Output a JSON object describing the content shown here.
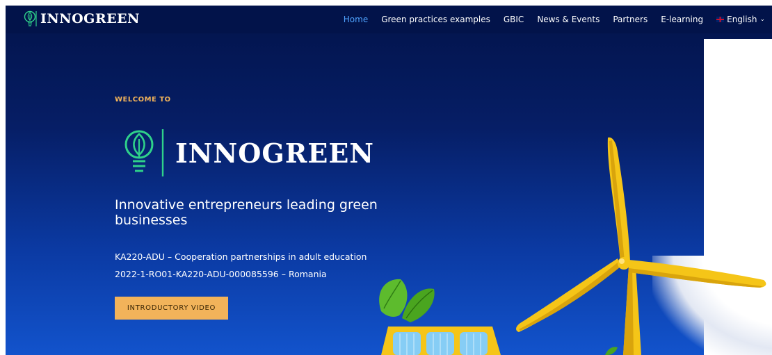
{
  "header": {
    "brand": "INNOGREEN",
    "nav": [
      {
        "label": "Home",
        "active": true
      },
      {
        "label": "Green practices examples",
        "active": false
      },
      {
        "label": "GBIC",
        "active": false
      },
      {
        "label": "News & Events",
        "active": false
      },
      {
        "label": "Partners",
        "active": false
      },
      {
        "label": "E-learning",
        "active": false
      }
    ],
    "language": {
      "label": "English",
      "icon": "uk-flag-icon"
    }
  },
  "hero": {
    "welcome": "WELCOME TO",
    "logo_text": "INNOGREEN",
    "tagline": "Innovative entrepreneurs leading green businesses",
    "project_line": "KA220-ADU – Cooperation partnerships in adult education",
    "project_id": "2022-1-RO01-KA220-ADU-000085596 – Romania",
    "cta_label": "INTRODUCTORY VIDEO"
  },
  "colors": {
    "nav_bg": "#02134a",
    "active_link": "#4fa3ff",
    "accent": "#f2b35a",
    "logo_green": "#2fd18a"
  }
}
